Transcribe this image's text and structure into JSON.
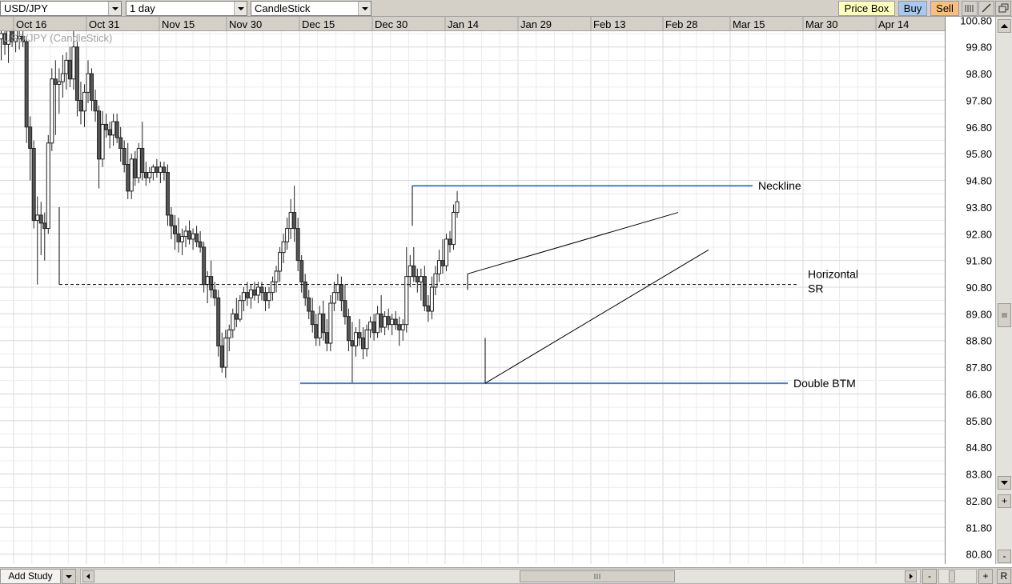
{
  "toolbar": {
    "symbol": "USD/JPY",
    "interval": "1 day",
    "chart_style": "CandleStick",
    "price_box_label": "Price Box",
    "buy_label": "Buy",
    "sell_label": "Sell"
  },
  "chart_legend": "USD/JPY (CandleStick)",
  "bottom": {
    "add_study_label": "Add Study",
    "minus_label": "-",
    "plus_label": "+",
    "reset_label": "R"
  },
  "vscroll": {
    "zoom_in_label": "+",
    "zoom_out_label": "-"
  },
  "colors": {
    "grid": "#d8d8d8",
    "annotation_line": "#4a7bd0",
    "candle_up": "#ffffff",
    "candle_down": "#555555",
    "price_box_bg": "#ffffc0",
    "buy_bg": "#a8c8f0",
    "sell_bg": "#f8c080"
  },
  "chart_data": {
    "type": "candlestick",
    "title": "USD/JPY (CandleStick)",
    "x_ticks": [
      "Oct 16",
      "Oct 31",
      "Nov 15",
      "Nov 30",
      "Dec 15",
      "Dec 30",
      "Jan 14",
      "Jan 29",
      "Feb 13",
      "Feb 28",
      "Mar 15",
      "Mar 30",
      "Apr 14"
    ],
    "y_ticks": [
      "99.80",
      "98.80",
      "97.80",
      "96.80",
      "95.80",
      "94.80",
      "93.80",
      "92.80",
      "91.80",
      "90.80",
      "89.80",
      "88.80",
      "87.80",
      "86.80",
      "85.80",
      "84.80",
      "83.80",
      "82.80",
      "81.80",
      "80.80"
    ],
    "ylim": [
      80.55,
      100.45
    ],
    "grid": true,
    "candles": [
      {
        "o": 100.4,
        "h": 100.9,
        "l": 99.6,
        "c": 100.1
      },
      {
        "o": 100.1,
        "h": 100.7,
        "l": 99.3,
        "c": 100.3
      },
      {
        "o": 100.3,
        "h": 100.8,
        "l": 99.5,
        "c": 99.9
      },
      {
        "o": 99.9,
        "h": 100.6,
        "l": 99.2,
        "c": 100.4
      },
      {
        "o": 100.4,
        "h": 100.9,
        "l": 99.8,
        "c": 100.0
      },
      {
        "o": 100.0,
        "h": 100.5,
        "l": 99.6,
        "c": 100.5
      },
      {
        "o": 100.1,
        "h": 100.6,
        "l": 99.7,
        "c": 100.2
      },
      {
        "o": 100.2,
        "h": 100.8,
        "l": 99.8,
        "c": 100.0
      },
      {
        "o": 100.0,
        "h": 100.2,
        "l": 96.2,
        "c": 96.8
      },
      {
        "o": 96.8,
        "h": 97.2,
        "l": 94.8,
        "c": 96.0
      },
      {
        "o": 96.0,
        "h": 96.3,
        "l": 93.0,
        "c": 93.3
      },
      {
        "o": 93.3,
        "h": 94.2,
        "l": 90.9,
        "c": 93.5
      },
      {
        "o": 93.5,
        "h": 94.0,
        "l": 92.0,
        "c": 93.2
      },
      {
        "o": 93.2,
        "h": 93.6,
        "l": 91.8,
        "c": 93.0
      },
      {
        "o": 93.0,
        "h": 96.5,
        "l": 92.8,
        "c": 96.2
      },
      {
        "o": 96.2,
        "h": 99.0,
        "l": 95.9,
        "c": 98.6
      },
      {
        "o": 98.6,
        "h": 99.3,
        "l": 96.5,
        "c": 98.4
      },
      {
        "o": 98.4,
        "h": 99.0,
        "l": 97.3,
        "c": 98.5
      },
      {
        "o": 98.5,
        "h": 99.5,
        "l": 97.9,
        "c": 98.8
      },
      {
        "o": 98.8,
        "h": 99.6,
        "l": 98.2,
        "c": 99.3
      },
      {
        "o": 99.3,
        "h": 99.8,
        "l": 98.3,
        "c": 98.6
      },
      {
        "o": 98.6,
        "h": 100.4,
        "l": 98.2,
        "c": 99.8
      },
      {
        "o": 99.8,
        "h": 100.0,
        "l": 97.2,
        "c": 97.8
      },
      {
        "o": 97.8,
        "h": 98.5,
        "l": 96.9,
        "c": 97.4
      },
      {
        "o": 97.4,
        "h": 98.4,
        "l": 96.8,
        "c": 98.1
      },
      {
        "o": 98.1,
        "h": 99.3,
        "l": 97.7,
        "c": 98.8
      },
      {
        "o": 98.8,
        "h": 99.0,
        "l": 97.4,
        "c": 97.8
      },
      {
        "o": 97.8,
        "h": 98.2,
        "l": 97.0,
        "c": 97.4
      },
      {
        "o": 97.4,
        "h": 97.6,
        "l": 94.5,
        "c": 95.6
      },
      {
        "o": 95.6,
        "h": 97.4,
        "l": 95.3,
        "c": 96.9
      },
      {
        "o": 96.9,
        "h": 97.3,
        "l": 96.4,
        "c": 96.7
      },
      {
        "o": 96.7,
        "h": 97.0,
        "l": 96.0,
        "c": 96.5
      },
      {
        "o": 96.5,
        "h": 97.3,
        "l": 96.1,
        "c": 97.0
      },
      {
        "o": 97.0,
        "h": 97.3,
        "l": 96.2,
        "c": 96.4
      },
      {
        "o": 96.4,
        "h": 96.8,
        "l": 95.5,
        "c": 96.0
      },
      {
        "o": 96.0,
        "h": 96.3,
        "l": 95.1,
        "c": 95.4
      },
      {
        "o": 95.4,
        "h": 96.2,
        "l": 94.1,
        "c": 94.4
      },
      {
        "o": 94.4,
        "h": 95.8,
        "l": 94.1,
        "c": 95.6
      },
      {
        "o": 95.6,
        "h": 95.9,
        "l": 94.6,
        "c": 94.9
      },
      {
        "o": 94.9,
        "h": 96.2,
        "l": 94.7,
        "c": 96.0
      },
      {
        "o": 96.0,
        "h": 97.0,
        "l": 94.8,
        "c": 95.1
      },
      {
        "o": 95.1,
        "h": 95.5,
        "l": 94.6,
        "c": 94.9
      },
      {
        "o": 94.9,
        "h": 95.3,
        "l": 94.7,
        "c": 95.1
      },
      {
        "o": 95.1,
        "h": 95.4,
        "l": 94.8,
        "c": 95.3
      },
      {
        "o": 95.3,
        "h": 95.6,
        "l": 94.9,
        "c": 95.1
      },
      {
        "o": 95.1,
        "h": 95.5,
        "l": 94.7,
        "c": 95.3
      },
      {
        "o": 95.3,
        "h": 95.5,
        "l": 94.8,
        "c": 95.1
      },
      {
        "o": 95.1,
        "h": 95.4,
        "l": 93.1,
        "c": 93.5
      },
      {
        "o": 93.5,
        "h": 93.8,
        "l": 92.6,
        "c": 93.1
      },
      {
        "o": 93.1,
        "h": 93.5,
        "l": 92.2,
        "c": 92.8
      },
      {
        "o": 92.8,
        "h": 93.4,
        "l": 92.1,
        "c": 92.5
      },
      {
        "o": 92.5,
        "h": 93.0,
        "l": 92.0,
        "c": 92.7
      },
      {
        "o": 92.7,
        "h": 93.1,
        "l": 92.3,
        "c": 92.9
      },
      {
        "o": 92.9,
        "h": 93.3,
        "l": 92.4,
        "c": 92.6
      },
      {
        "o": 92.6,
        "h": 93.0,
        "l": 92.2,
        "c": 92.8
      },
      {
        "o": 92.8,
        "h": 93.1,
        "l": 92.3,
        "c": 92.5
      },
      {
        "o": 92.5,
        "h": 92.9,
        "l": 92.1,
        "c": 92.3
      },
      {
        "o": 92.3,
        "h": 92.5,
        "l": 90.6,
        "c": 90.9
      },
      {
        "o": 90.9,
        "h": 91.4,
        "l": 90.2,
        "c": 91.2
      },
      {
        "o": 91.2,
        "h": 91.8,
        "l": 90.4,
        "c": 90.7
      },
      {
        "o": 90.7,
        "h": 91.0,
        "l": 90.1,
        "c": 90.4
      },
      {
        "o": 90.4,
        "h": 90.7,
        "l": 88.2,
        "c": 88.6
      },
      {
        "o": 88.6,
        "h": 89.1,
        "l": 87.6,
        "c": 87.8
      },
      {
        "o": 87.8,
        "h": 89.2,
        "l": 87.4,
        "c": 88.9
      },
      {
        "o": 88.9,
        "h": 89.4,
        "l": 88.4,
        "c": 89.2
      },
      {
        "o": 89.2,
        "h": 90.0,
        "l": 88.9,
        "c": 89.8
      },
      {
        "o": 89.8,
        "h": 90.4,
        "l": 89.3,
        "c": 89.6
      },
      {
        "o": 89.6,
        "h": 90.5,
        "l": 89.5,
        "c": 90.3
      },
      {
        "o": 90.3,
        "h": 90.8,
        "l": 89.9,
        "c": 90.6
      },
      {
        "o": 90.6,
        "h": 91.0,
        "l": 90.1,
        "c": 90.4
      },
      {
        "o": 90.4,
        "h": 90.9,
        "l": 90.0,
        "c": 90.7
      },
      {
        "o": 90.7,
        "h": 91.0,
        "l": 90.3,
        "c": 90.5
      },
      {
        "o": 90.5,
        "h": 91.0,
        "l": 90.2,
        "c": 90.8
      },
      {
        "o": 90.8,
        "h": 91.0,
        "l": 90.3,
        "c": 90.6
      },
      {
        "o": 90.6,
        "h": 90.8,
        "l": 89.9,
        "c": 90.3
      },
      {
        "o": 90.3,
        "h": 90.8,
        "l": 90.0,
        "c": 90.6
      },
      {
        "o": 90.6,
        "h": 91.2,
        "l": 90.3,
        "c": 91.0
      },
      {
        "o": 91.0,
        "h": 91.6,
        "l": 90.6,
        "c": 91.4
      },
      {
        "o": 91.4,
        "h": 92.3,
        "l": 91.0,
        "c": 92.1
      },
      {
        "o": 92.1,
        "h": 92.8,
        "l": 91.7,
        "c": 92.5
      },
      {
        "o": 92.5,
        "h": 93.4,
        "l": 92.2,
        "c": 93.0
      },
      {
        "o": 93.0,
        "h": 94.1,
        "l": 92.6,
        "c": 93.6
      },
      {
        "o": 93.6,
        "h": 94.6,
        "l": 92.5,
        "c": 93.0
      },
      {
        "o": 93.0,
        "h": 93.4,
        "l": 91.4,
        "c": 91.8
      },
      {
        "o": 91.8,
        "h": 92.0,
        "l": 90.6,
        "c": 91.0
      },
      {
        "o": 91.0,
        "h": 91.3,
        "l": 90.1,
        "c": 90.4
      },
      {
        "o": 90.4,
        "h": 90.7,
        "l": 89.6,
        "c": 89.9
      },
      {
        "o": 89.9,
        "h": 90.4,
        "l": 89.1,
        "c": 89.4
      },
      {
        "o": 89.4,
        "h": 89.8,
        "l": 88.6,
        "c": 88.9
      },
      {
        "o": 88.9,
        "h": 90.1,
        "l": 88.6,
        "c": 89.8
      },
      {
        "o": 89.8,
        "h": 90.3,
        "l": 88.8,
        "c": 89.1
      },
      {
        "o": 89.1,
        "h": 89.6,
        "l": 88.4,
        "c": 88.7
      },
      {
        "o": 88.7,
        "h": 90.5,
        "l": 88.4,
        "c": 90.2
      },
      {
        "o": 90.2,
        "h": 91.0,
        "l": 89.9,
        "c": 90.6
      },
      {
        "o": 90.6,
        "h": 91.3,
        "l": 90.3,
        "c": 90.9
      },
      {
        "o": 90.9,
        "h": 91.2,
        "l": 89.9,
        "c": 90.3
      },
      {
        "o": 90.3,
        "h": 90.9,
        "l": 89.4,
        "c": 89.7
      },
      {
        "o": 89.7,
        "h": 90.0,
        "l": 88.4,
        "c": 88.8
      },
      {
        "o": 88.8,
        "h": 89.5,
        "l": 87.2,
        "c": 88.6
      },
      {
        "o": 88.6,
        "h": 89.3,
        "l": 88.2,
        "c": 89.1
      },
      {
        "o": 89.1,
        "h": 89.6,
        "l": 88.6,
        "c": 88.9
      },
      {
        "o": 88.9,
        "h": 89.3,
        "l": 88.1,
        "c": 88.5
      },
      {
        "o": 88.5,
        "h": 89.4,
        "l": 88.2,
        "c": 89.2
      },
      {
        "o": 89.2,
        "h": 89.7,
        "l": 88.9,
        "c": 89.5
      },
      {
        "o": 89.5,
        "h": 89.8,
        "l": 88.8,
        "c": 89.1
      },
      {
        "o": 89.1,
        "h": 90.1,
        "l": 88.9,
        "c": 89.8
      },
      {
        "o": 89.8,
        "h": 90.5,
        "l": 89.1,
        "c": 89.3
      },
      {
        "o": 89.3,
        "h": 89.9,
        "l": 89.0,
        "c": 89.7
      },
      {
        "o": 89.7,
        "h": 90.0,
        "l": 89.2,
        "c": 89.4
      },
      {
        "o": 89.4,
        "h": 89.8,
        "l": 89.0,
        "c": 89.6
      },
      {
        "o": 89.6,
        "h": 89.9,
        "l": 89.2,
        "c": 89.4
      },
      {
        "o": 89.4,
        "h": 89.7,
        "l": 88.6,
        "c": 89.2
      },
      {
        "o": 89.2,
        "h": 89.6,
        "l": 88.8,
        "c": 89.4
      },
      {
        "o": 89.4,
        "h": 92.3,
        "l": 89.1,
        "c": 91.2
      },
      {
        "o": 91.2,
        "h": 92.0,
        "l": 90.8,
        "c": 91.6
      },
      {
        "o": 91.6,
        "h": 92.3,
        "l": 91.0,
        "c": 91.2
      },
      {
        "o": 91.2,
        "h": 91.5,
        "l": 90.6,
        "c": 91.0
      },
      {
        "o": 91.0,
        "h": 91.5,
        "l": 90.3,
        "c": 91.2
      },
      {
        "o": 91.2,
        "h": 91.6,
        "l": 89.9,
        "c": 90.1
      },
      {
        "o": 90.1,
        "h": 90.5,
        "l": 89.5,
        "c": 89.9
      },
      {
        "o": 89.9,
        "h": 91.2,
        "l": 89.6,
        "c": 90.8
      },
      {
        "o": 90.8,
        "h": 91.6,
        "l": 90.5,
        "c": 91.3
      },
      {
        "o": 91.3,
        "h": 92.2,
        "l": 91.0,
        "c": 91.8
      },
      {
        "o": 91.8,
        "h": 92.6,
        "l": 91.3,
        "c": 91.6
      },
      {
        "o": 91.6,
        "h": 92.8,
        "l": 91.4,
        "c": 92.6
      },
      {
        "o": 92.6,
        "h": 92.9,
        "l": 92.1,
        "c": 92.4
      },
      {
        "o": 92.4,
        "h": 93.9,
        "l": 92.2,
        "c": 93.6
      },
      {
        "o": 93.6,
        "h": 94.4,
        "l": 93.4,
        "c": 94.0
      }
    ],
    "annotations": [
      {
        "label": "Neckline",
        "kind": "level",
        "value": 94.6
      },
      {
        "label": "Horizontal SR",
        "kind": "dashed-level",
        "value": 90.9
      },
      {
        "label": "Double BTM",
        "kind": "level",
        "value": 87.2
      }
    ]
  }
}
